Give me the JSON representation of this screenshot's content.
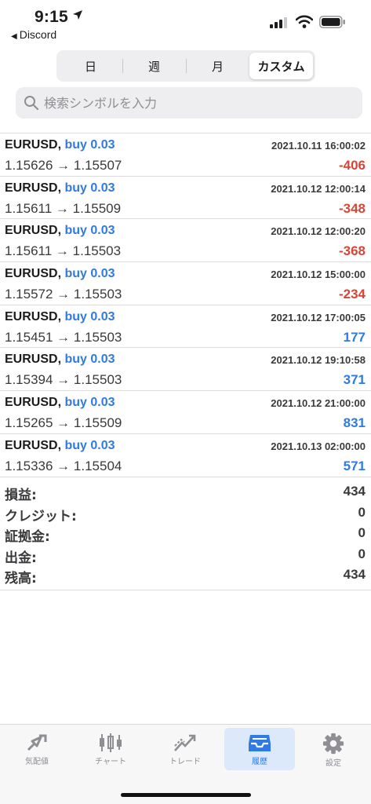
{
  "status_bar": {
    "time": "9:15",
    "back_app": "Discord"
  },
  "segments": [
    "日",
    "週",
    "月",
    "カスタム"
  ],
  "search": {
    "placeholder": "検索シンボルを入力"
  },
  "trades": [
    {
      "symbol": "EURUSD,",
      "side": "buy 0.03",
      "datetime": "2021.10.11 16:00:02",
      "prices": "1.15626 → 1.15507",
      "pl": "-406",
      "sign": "neg"
    },
    {
      "symbol": "EURUSD,",
      "side": "buy 0.03",
      "datetime": "2021.10.12 12:00:14",
      "prices": "1.15611 → 1.15509",
      "pl": "-348",
      "sign": "neg"
    },
    {
      "symbol": "EURUSD,",
      "side": "buy 0.03",
      "datetime": "2021.10.12 12:00:20",
      "prices": "1.15611 → 1.15503",
      "pl": "-368",
      "sign": "neg"
    },
    {
      "symbol": "EURUSD,",
      "side": "buy 0.03",
      "datetime": "2021.10.12 15:00:00",
      "prices": "1.15572 → 1.15503",
      "pl": "-234",
      "sign": "neg"
    },
    {
      "symbol": "EURUSD,",
      "side": "buy 0.03",
      "datetime": "2021.10.12 17:00:05",
      "prices": "1.15451 → 1.15503",
      "pl": "177",
      "sign": "pos"
    },
    {
      "symbol": "EURUSD,",
      "side": "buy 0.03",
      "datetime": "2021.10.12 19:10:58",
      "prices": "1.15394 → 1.15503",
      "pl": "371",
      "sign": "pos"
    },
    {
      "symbol": "EURUSD,",
      "side": "buy 0.03",
      "datetime": "2021.10.12 21:00:00",
      "prices": "1.15265 → 1.15509",
      "pl": "831",
      "sign": "pos"
    },
    {
      "symbol": "EURUSD,",
      "side": "buy 0.03",
      "datetime": "2021.10.13 02:00:00",
      "prices": "1.15336 → 1.15504",
      "pl": "571",
      "sign": "pos"
    }
  ],
  "summary": [
    {
      "label": "損益:",
      "value": "434"
    },
    {
      "label": "クレジット:",
      "value": "0"
    },
    {
      "label": "証拠金:",
      "value": "0"
    },
    {
      "label": "出金:",
      "value": "0"
    },
    {
      "label": "残高:",
      "value": "434"
    }
  ],
  "tabs": [
    {
      "label": "気配値",
      "icon": "quotes-icon"
    },
    {
      "label": "チャート",
      "icon": "candlestick-chart-icon"
    },
    {
      "label": "トレード",
      "icon": "trade-icon"
    },
    {
      "label": "履歴",
      "icon": "history-inbox-icon"
    },
    {
      "label": "設定",
      "icon": "gear-icon"
    }
  ],
  "colors": {
    "buy": "#2f7ae5",
    "loss": "#d64535",
    "profit": "#2f7ae5",
    "active_tab": "#2f7ae5"
  }
}
